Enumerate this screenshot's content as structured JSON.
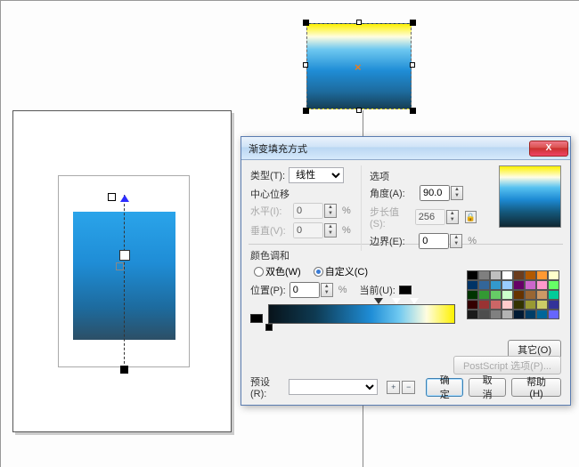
{
  "dialog": {
    "title": "渐变填充方式",
    "type_label": "类型(T):",
    "type_value": "线性",
    "center_label": "中心位移",
    "horiz_label": "水平(I):",
    "vert_label": "垂直(V):",
    "horiz_value": "0",
    "vert_value": "0",
    "options_label": "选项",
    "angle_label": "角度(A):",
    "angle_value": "90.0",
    "step_label": "步长值(S):",
    "step_value": "256",
    "edge_label": "边界(E):",
    "edge_value": "0",
    "blend_label": "颜色调和",
    "two_color": "双色(W)",
    "custom": "自定义(C)",
    "position_label": "位置(P):",
    "position_value": "0",
    "current_label": "当前(U):",
    "other_btn": "其它(O)",
    "preset_label": "预设(R):",
    "postscript_btn": "PostScript 选项(P)...",
    "ok": "确定",
    "cancel": "取消",
    "help": "帮助(H)",
    "percent": "%"
  },
  "palette_colors": [
    [
      "#000000",
      "#7f7f7f",
      "#bfbfbf",
      "#ffffff",
      "#6b3d1e",
      "#b25900",
      "#ff9933",
      "#ffffcc"
    ],
    [
      "#003366",
      "#336699",
      "#3399cc",
      "#99ccff",
      "#660066",
      "#cc66cc",
      "#ff99cc",
      "#66ff66"
    ],
    [
      "#003300",
      "#339933",
      "#66cc66",
      "#ccffcc",
      "#663300",
      "#996633",
      "#cc9966",
      "#00cc99"
    ],
    [
      "#330000",
      "#993333",
      "#cc6666",
      "#ffcccc",
      "#333300",
      "#999933",
      "#cccc66",
      "#333399"
    ],
    [
      "#1a1a1a",
      "#4d4d4d",
      "#808080",
      "#b3b3b3",
      "#001a33",
      "#003d66",
      "#006699",
      "#6666ff"
    ]
  ],
  "chart_data": {
    "type": "gradient",
    "direction": "vertical",
    "angle": 90.0,
    "stops": [
      {
        "pos": 0,
        "color": "#fdf100"
      },
      {
        "pos": 18,
        "color": "#fffde5"
      },
      {
        "pos": 35,
        "color": "#57c2f0"
      },
      {
        "pos": 55,
        "color": "#1d8ad3"
      },
      {
        "pos": 75,
        "color": "#14597e"
      },
      {
        "pos": 100,
        "color": "#102631"
      }
    ]
  }
}
